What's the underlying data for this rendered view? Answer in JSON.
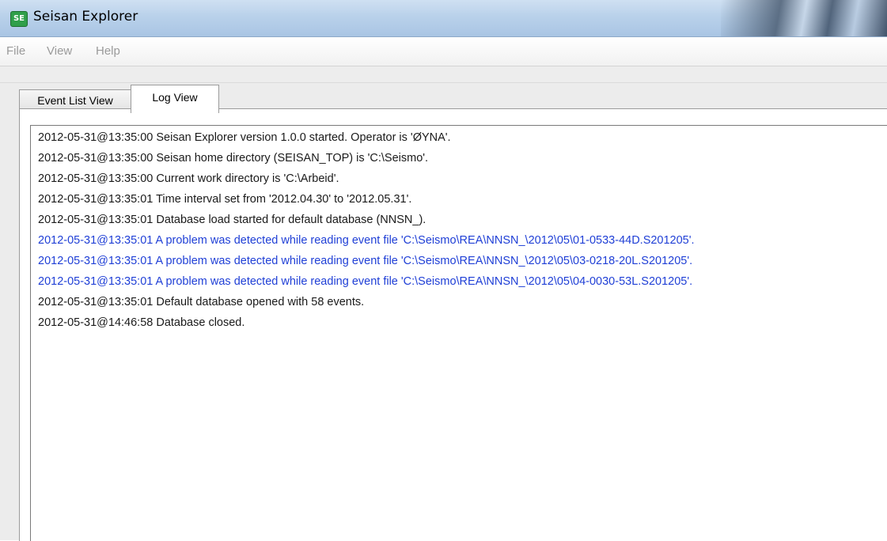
{
  "window": {
    "title": "Seisan Explorer",
    "icon_label": "SE"
  },
  "menu": {
    "items": [
      "File",
      "View",
      "Help"
    ]
  },
  "tabs": [
    {
      "label": "Event List View",
      "active": false
    },
    {
      "label": "Log View",
      "active": true
    }
  ],
  "log": {
    "lines": [
      {
        "text": "2012-05-31@13:35:00 Seisan Explorer version 1.0.0 started. Operator is 'ØYNA'.",
        "level": "info"
      },
      {
        "text": "2012-05-31@13:35:00 Seisan home directory (SEISAN_TOP) is 'C:\\Seismo'.",
        "level": "info"
      },
      {
        "text": "2012-05-31@13:35:00 Current work directory is 'C:\\Arbeid'.",
        "level": "info"
      },
      {
        "text": "2012-05-31@13:35:01 Time interval set from '2012.04.30' to '2012.05.31'.",
        "level": "info"
      },
      {
        "text": "2012-05-31@13:35:01 Database load started for default database (NNSN_).",
        "level": "info"
      },
      {
        "text": "2012-05-31@13:35:01 A problem was detected while reading event file 'C:\\Seismo\\REA\\NNSN_\\2012\\05\\01-0533-44D.S201205'.",
        "level": "warning"
      },
      {
        "text": "2012-05-31@13:35:01 A problem was detected while reading event file 'C:\\Seismo\\REA\\NNSN_\\2012\\05\\03-0218-20L.S201205'.",
        "level": "warning"
      },
      {
        "text": "2012-05-31@13:35:01 A problem was detected while reading event file 'C:\\Seismo\\REA\\NNSN_\\2012\\05\\04-0030-53L.S201205'.",
        "level": "warning"
      },
      {
        "text": "2012-05-31@13:35:01 Default database opened with 58 events.",
        "level": "info"
      },
      {
        "text": "2012-05-31@14:46:58 Database closed.",
        "level": "info"
      }
    ]
  },
  "colors": {
    "info_text": "#1a1a1a",
    "warning_text": "#1f3fd6",
    "menu_disabled": "#9a9a9a"
  }
}
